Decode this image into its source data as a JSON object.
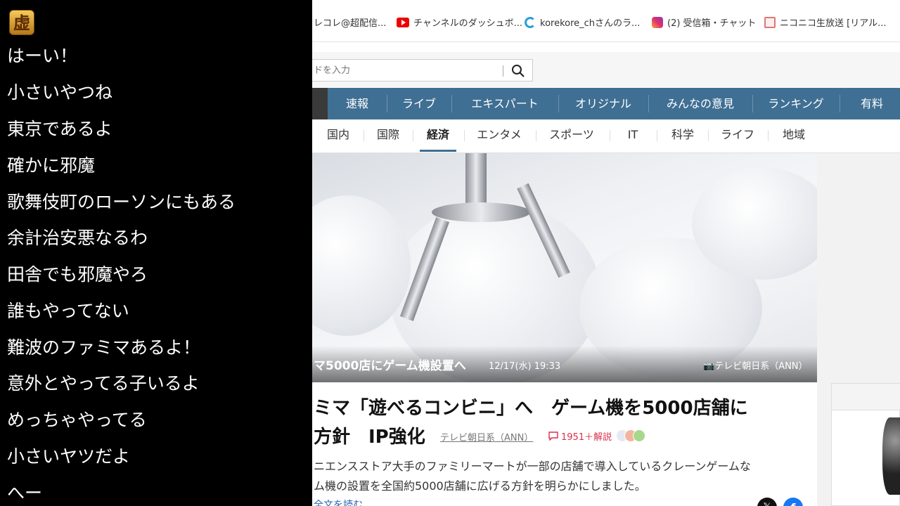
{
  "comments": {
    "badge_char": "虚",
    "lines": [
      "はーい！",
      "小さいやつね",
      "東京であるよ",
      "確かに邪魔",
      "歌舞伎町のローソンにもある",
      "余計治安悪なるわ",
      "田舎でも邪魔やろ",
      "誰もやってない",
      "難波のファミマあるよ！",
      "意外とやってる子いるよ",
      "めっちゃやってる",
      "小さいヤツだよ",
      "へー"
    ]
  },
  "bookmarks": [
    {
      "label": "レコレ@超配信...",
      "icon": "none"
    },
    {
      "label": "チャンネルのダッシュボ...",
      "icon": "youtube-icon"
    },
    {
      "label": "korekore_chさんのラ...",
      "icon": "spinner-icon"
    },
    {
      "label": "(2) 受信箱・チャット",
      "icon": "instagram-icon"
    },
    {
      "label": "ニコニコ生放送 [リアル...",
      "icon": "niconico-icon"
    }
  ],
  "search": {
    "placeholder": "ドを入力"
  },
  "nav": {
    "items": [
      "速報",
      "ライブ",
      "エキスパート",
      "オリジナル",
      "みんなの意見",
      "ランキング",
      "有料"
    ]
  },
  "subnav": {
    "items": [
      "国内",
      "国際",
      "経済",
      "エンタメ",
      "スポーツ",
      "IT",
      "科学",
      "ライフ",
      "地域"
    ],
    "active": "経済"
  },
  "hero": {
    "caption_title": "マ5000店にゲーム機設置へ",
    "caption_date": "12/17(水) 19:33",
    "caption_source": "テレビ朝日系（ANN）"
  },
  "article": {
    "headline_line1": "ミマ「遊べるコンビニ」へ　ゲーム機を5000店舗に",
    "headline_line2": "方針　IP強化",
    "source": "テレビ朝日系（ANN）",
    "comment_count": "1951＋解説",
    "summary_line1": "ニエンスストア大手のファミリーマートが一部の店舗で導入しているクレーンゲームな",
    "summary_line2": "ム機の設置を全国約5000店舗に広げる方針を明らかにしました。",
    "read_more": "全文を読む",
    "share_x": "𝕏",
    "share_fb": "f"
  },
  "colors": {
    "nav_bg": "#3f6f93",
    "comment_text": "#ffffff",
    "comment_count": "#d9304a",
    "link": "#2466b0"
  }
}
